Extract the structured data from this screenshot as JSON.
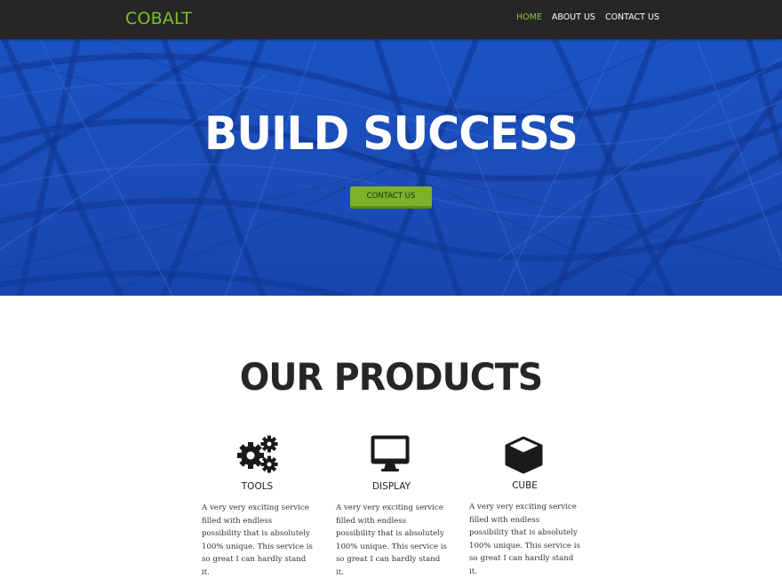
{
  "nav": {
    "brand": "COBALT",
    "links": [
      {
        "label": "HOME",
        "active": true
      },
      {
        "label": "ABOUT US",
        "active": false
      },
      {
        "label": "CONTACT US",
        "active": false
      }
    ]
  },
  "hero": {
    "title": "BUILD SUCCESS",
    "button_label": "CONTACT US"
  },
  "products": {
    "title": "OUR PRODUCTS",
    "items": [
      {
        "name": "TOOLS",
        "icon": "gears-icon",
        "description": "A very very exciting service filled with endless possibility that is absolutely 100% unique. This service is so great I can hardly stand it."
      },
      {
        "name": "DISPLAY",
        "icon": "desktop-icon",
        "description": "A very very exciting service filled with endless possibility that is absolutely 100% unique. This service is so great I can hardly stand it."
      },
      {
        "name": "CUBE",
        "icon": "cube-icon",
        "description": "A very very exciting service filled with endless possibility that is absolutely 100% unique. This service is so great I can hardly stand it."
      }
    ]
  },
  "colors": {
    "accent_green": "#7cb228",
    "brand_green": "#7cbf2a",
    "hero_blue": "#1a4fbf",
    "navbar": "#262626",
    "heading": "#262626"
  }
}
